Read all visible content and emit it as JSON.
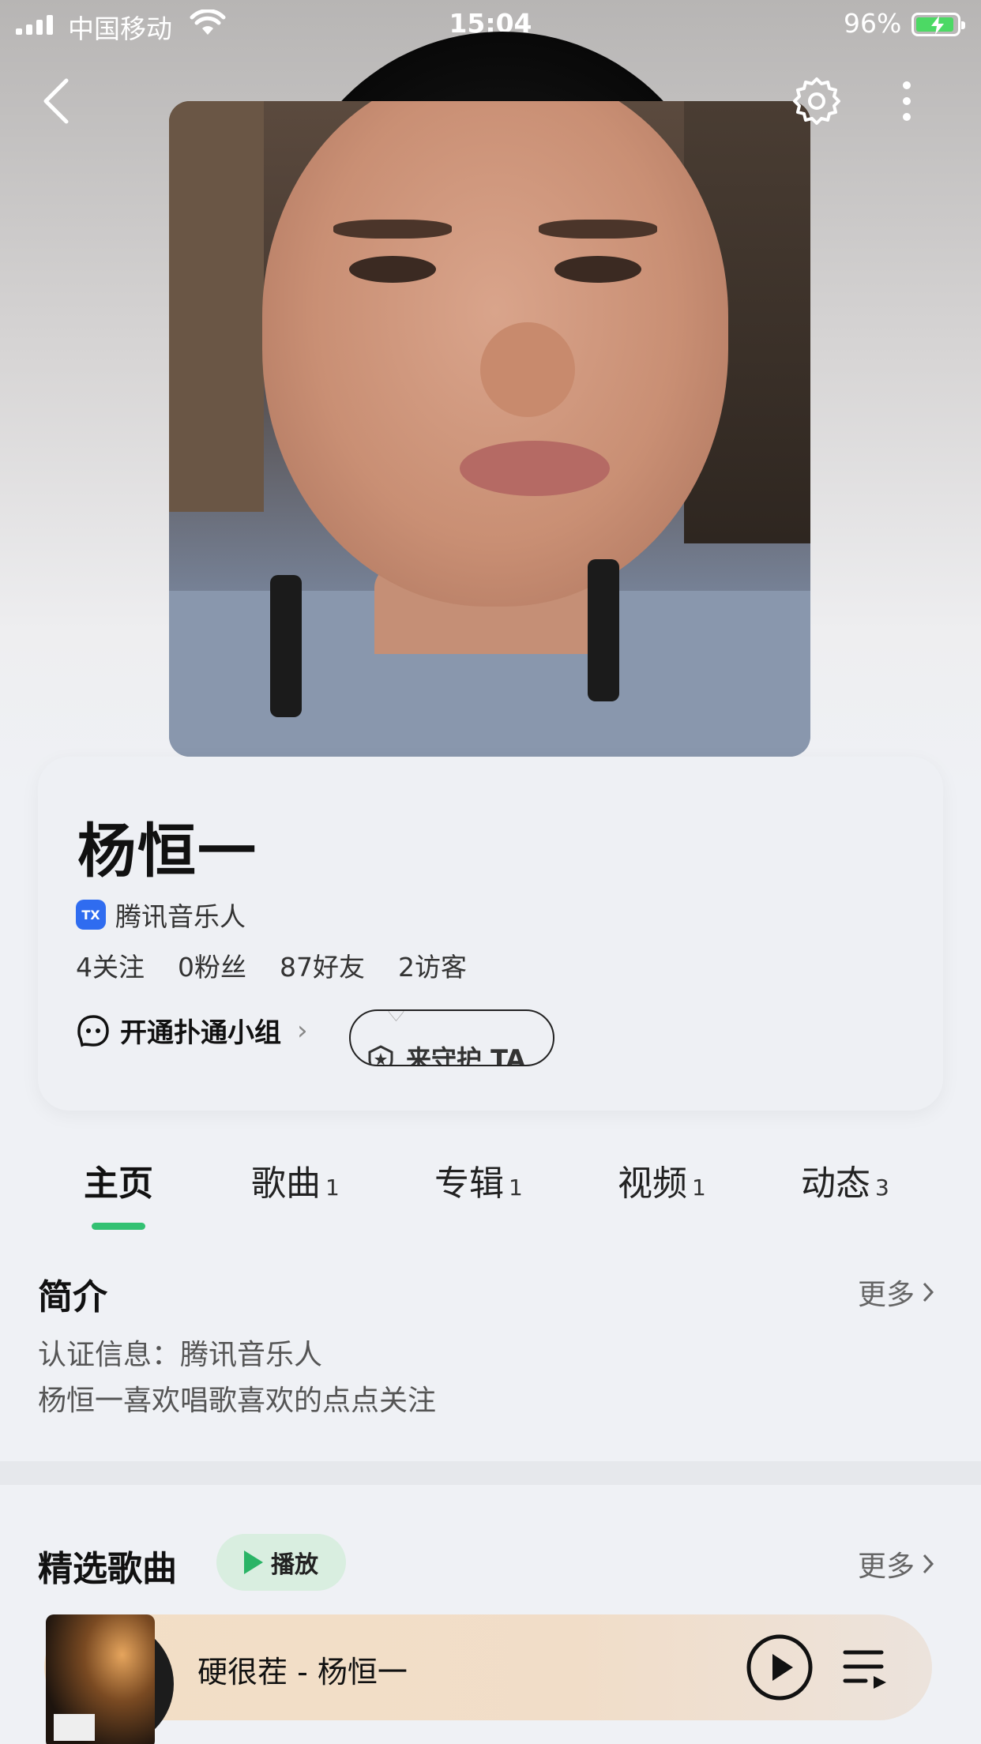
{
  "status_bar": {
    "carrier": "中国移动",
    "time": "15:04",
    "battery": "96%"
  },
  "profile": {
    "name": "杨恒一",
    "badge": "腾讯音乐人",
    "stats": [
      "4关注",
      "0粉丝",
      "87好友",
      "2访客"
    ],
    "group_link": "开通扑通小组",
    "guard_button": "来守护 TA"
  },
  "tabs": [
    {
      "label": "主页",
      "count": ""
    },
    {
      "label": "歌曲",
      "count": "1"
    },
    {
      "label": "专辑",
      "count": "1"
    },
    {
      "label": "视频",
      "count": "1"
    },
    {
      "label": "动态",
      "count": "3"
    }
  ],
  "intro": {
    "title": "简介",
    "more": "更多",
    "lines": [
      "认证信息：腾讯音乐人",
      "杨恒一喜欢唱歌喜欢的点点关注"
    ]
  },
  "featured": {
    "title": "精选歌曲",
    "play_label": "播放",
    "more": "更多"
  },
  "player": {
    "now_playing": "硬很茬 - 杨恒一"
  },
  "colors": {
    "accent": "#33c172",
    "play_green": "#2ab466",
    "badge_blue": "#2f6cf0"
  }
}
